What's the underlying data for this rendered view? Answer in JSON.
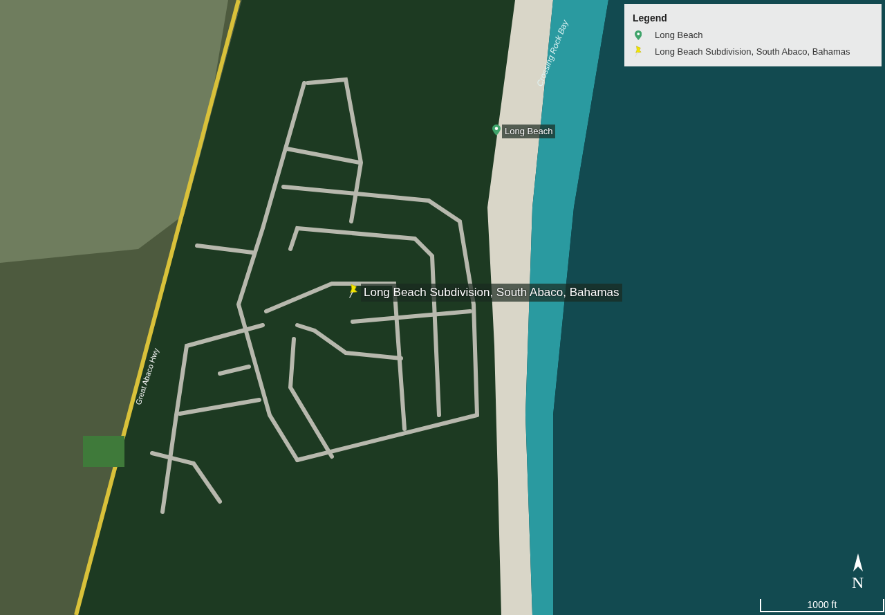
{
  "map": {
    "labels": [
      {
        "kind": "road",
        "text": "Great Abaco Hwy"
      },
      {
        "kind": "water",
        "text": "Crossing Rock Bay"
      }
    ],
    "placemarks": [
      {
        "kind": "pin",
        "text": "Long Beach"
      },
      {
        "kind": "pushpin",
        "text": "Long Beach Subdivision, South Abaco, Bahamas"
      }
    ]
  },
  "legend": {
    "title": "Legend",
    "items": [
      {
        "kind": "pin",
        "label": "Long Beach"
      },
      {
        "kind": "pushpin",
        "label": "Long Beach Subdivision, South Abaco, Bahamas"
      }
    ]
  },
  "compass": {
    "label": "N"
  },
  "scale_bar": {
    "label": "1000 ft"
  }
}
